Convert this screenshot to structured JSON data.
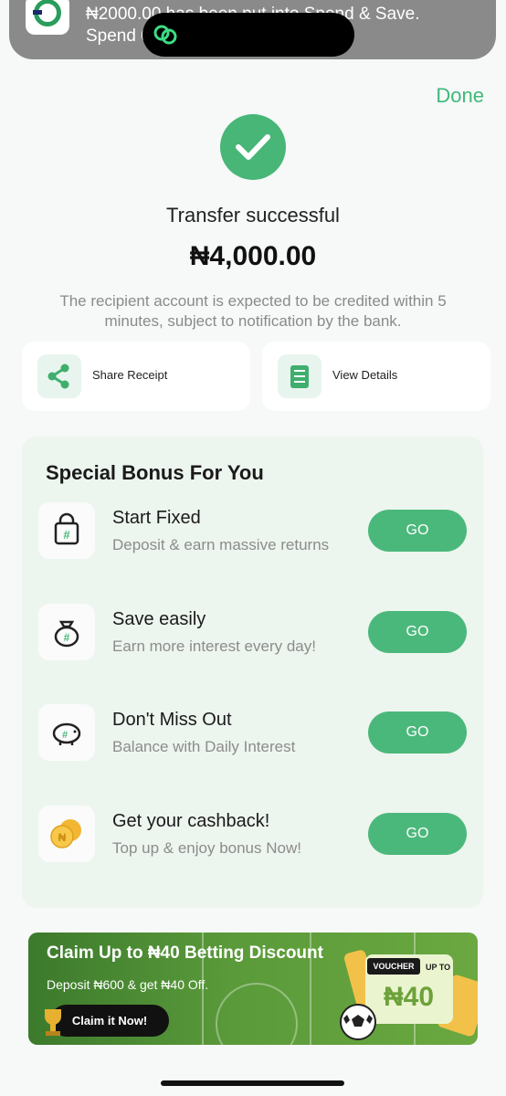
{
  "notification": {
    "text": "₦2000.00 has been put into Spend & Save.\nSpend                                                            0."
  },
  "header": {
    "done_label": "Done"
  },
  "result": {
    "title": "Transfer successful",
    "amount": "₦4,000.00",
    "note": "The recipient account is expected to be credited within 5 minutes, subject to notification by the bank."
  },
  "actions": [
    {
      "label": "Share Receipt",
      "icon": "share-icon"
    },
    {
      "label": "View Details",
      "icon": "list-icon"
    }
  ],
  "bonus": {
    "title": "Special Bonus For You",
    "items": [
      {
        "title": "Start Fixed",
        "desc": "Deposit & earn massive returns",
        "button": "GO",
        "icon": "lock-bag-icon"
      },
      {
        "title": "Save easily",
        "desc": "Earn more interest every day!",
        "button": "GO",
        "icon": "money-bag-icon"
      },
      {
        "title": "Don't Miss Out",
        "desc": "Balance with Daily Interest",
        "button": "GO",
        "icon": "piggy-bank-icon"
      },
      {
        "title": "Get your cashback!",
        "desc": "Top up & enjoy bonus Now!",
        "button": "GO",
        "icon": "coins-icon"
      }
    ]
  },
  "promo": {
    "headline": "Claim Up to ₦40 Betting Discount",
    "sub": "Deposit ₦600 & get ₦40 Off.",
    "cta": "Claim it Now!",
    "voucher_tag": "VOUCHER",
    "voucher_up": "UP TO",
    "voucher_amount": "₦40"
  },
  "colors": {
    "accent": "#4bb87b",
    "done": "#3fb87a",
    "check_bg": "#47b677"
  }
}
